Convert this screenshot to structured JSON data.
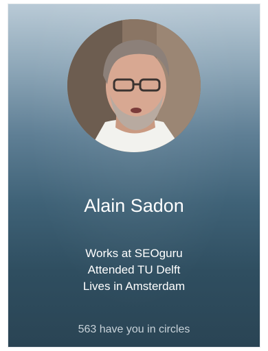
{
  "profile": {
    "name": "Alain Sadon",
    "work": "Works at SEOguru",
    "education": "Attended TU Delft",
    "location": "Lives in Amsterdam",
    "circles_text": "563 have you in circles"
  },
  "colors": {
    "card_top": "#b9cad6",
    "card_bottom": "#2a4454",
    "text_primary": "#ffffff",
    "text_secondary": "#c9d3da"
  }
}
